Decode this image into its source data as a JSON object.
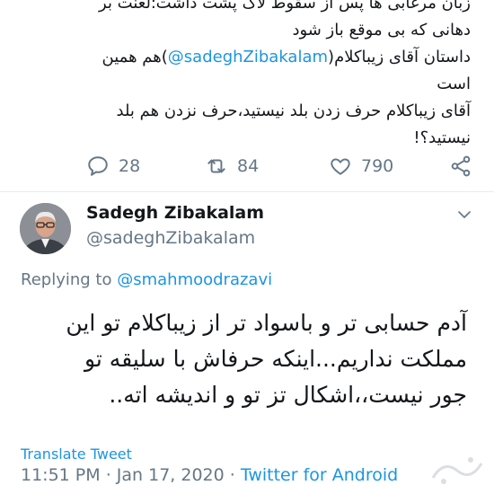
{
  "prev_tweet": {
    "lines": [
      "زبان مرغابی ها پس از سقوط لاک پشت داشت؛لعنت بر",
      "دهانی که بی موقع باز شود",
      "داستان آقای زیباکلام",
      "@sadeghZibakalam",
      "هم همین",
      "است",
      "آقای زیباکلام حرف زدن بلد نیستید،حرف نزدن هم بلد",
      "نیستید؟!"
    ],
    "replies": "28",
    "retweets": "84",
    "likes": "790"
  },
  "tweet": {
    "author_name": "Sadegh Zibakalam",
    "author_handle": "@sadeghZibakalam",
    "replying_label": "Replying to",
    "replying_to": "@smahmoodrazavi",
    "lines": [
      "آدم حسابی تر و باسواد تر از زیباکلام تو این",
      "مملکت نداریم...اینکه حرفاش با سلیقه تو",
      "جور نیست،،اشکال تز تو و اندیشه اته.."
    ],
    "translate_label": "Translate Tweet",
    "time": "11:51 PM",
    "dot1": "·",
    "date": "Jan 17, 2020",
    "dot2": "·",
    "source": "Twitter for Android"
  },
  "icons": {
    "reply": "reply-icon",
    "retweet": "retweet-icon",
    "like": "heart-icon",
    "share": "share-icon",
    "menu": "chevron-down-icon"
  },
  "colors": {
    "link": "#1b95e0",
    "muted": "#657786",
    "text": "#14171a"
  }
}
